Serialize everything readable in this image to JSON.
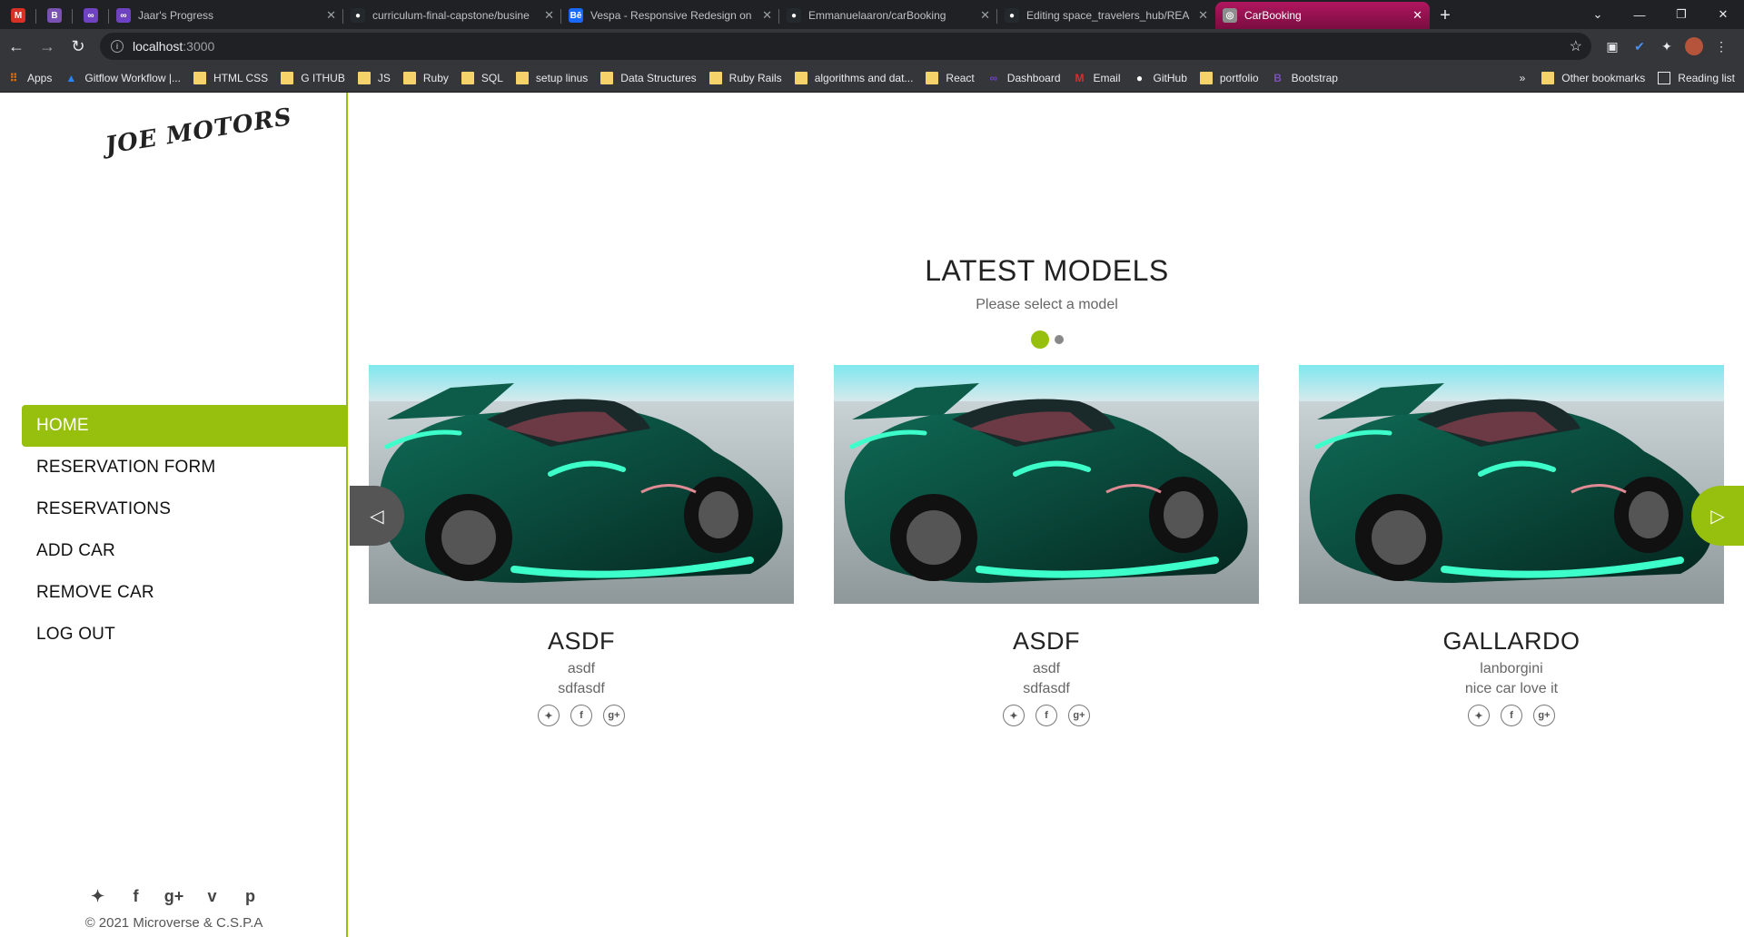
{
  "browser": {
    "tabs": [
      {
        "title": "",
        "icon": "gmail-icon",
        "color": "#d93025",
        "glyph": "M",
        "pinned": true
      },
      {
        "title": "",
        "icon": "bootstrap-icon",
        "color": "#7952b3",
        "glyph": "B",
        "pinned": true
      },
      {
        "title": "",
        "icon": "microverse-icon",
        "color": "#6f42c1",
        "glyph": "∞",
        "pinned": true
      },
      {
        "title": "Jaar's Progress",
        "icon": "microverse-icon",
        "color": "#6f42c1",
        "glyph": "∞"
      },
      {
        "title": "curriculum-final-capstone/busine",
        "icon": "github-icon",
        "color": "#24292e",
        "glyph": "●"
      },
      {
        "title": "Vespa - Responsive Redesign on",
        "icon": "behance-icon",
        "color": "#1769ff",
        "glyph": "Bē"
      },
      {
        "title": "Emmanuelaaron/carBooking",
        "icon": "github-icon",
        "color": "#24292e",
        "glyph": "●"
      },
      {
        "title": "Editing space_travelers_hub/REA",
        "icon": "github-icon",
        "color": "#24292e",
        "glyph": "●"
      },
      {
        "title": "CarBooking",
        "icon": "globe-icon",
        "color": "#8e8e8e",
        "glyph": "◎",
        "active": true
      }
    ],
    "url_host": "localhost",
    "url_port": ":3000",
    "bookmarks": [
      {
        "label": "Apps",
        "icon": "apps-icon",
        "color": "#e8710a"
      },
      {
        "label": "Gitflow Workflow |...",
        "icon": "atlassian-icon",
        "color": "#2684ff"
      },
      {
        "label": "HTML CSS",
        "icon": "folder-icon"
      },
      {
        "label": "G ITHUB",
        "icon": "folder-icon"
      },
      {
        "label": "JS",
        "icon": "folder-icon"
      },
      {
        "label": "Ruby",
        "icon": "folder-icon"
      },
      {
        "label": "SQL",
        "icon": "folder-icon"
      },
      {
        "label": "setup linus",
        "icon": "folder-icon"
      },
      {
        "label": "Data Structures",
        "icon": "folder-icon"
      },
      {
        "label": "Ruby Rails",
        "icon": "folder-icon"
      },
      {
        "label": "algorithms and dat...",
        "icon": "folder-icon"
      },
      {
        "label": "React",
        "icon": "folder-icon"
      },
      {
        "label": "Dashboard",
        "icon": "microverse-icon",
        "color": "#6f42c1"
      },
      {
        "label": "Email",
        "icon": "gmail-icon",
        "color": "#d93025"
      },
      {
        "label": "GitHub",
        "icon": "github-icon",
        "color": "#ffffff"
      },
      {
        "label": "portfolio",
        "icon": "folder-icon"
      },
      {
        "label": "Bootstrap",
        "icon": "bootstrap-icon",
        "color": "#7952b3"
      }
    ],
    "other_bookmarks": "Other bookmarks",
    "reading_list": "Reading list",
    "overflow": "»"
  },
  "app": {
    "logo": "JOE MOTORS",
    "nav": [
      {
        "label": "HOME",
        "active": true
      },
      {
        "label": "RESERVATION FORM"
      },
      {
        "label": "RESERVATIONS"
      },
      {
        "label": "ADD CAR"
      },
      {
        "label": "REMOVE CAR"
      },
      {
        "label": "LOG OUT"
      }
    ],
    "side_social": [
      "twitter-icon",
      "facebook-icon",
      "google-plus-icon",
      "vimeo-icon",
      "pinterest-icon"
    ],
    "copyright": "© 2021 Microverse & C.S.P.A",
    "heading": "LATEST MODELS",
    "subheading": "Please select a model",
    "carousel_pages": 2,
    "carousel_active": 0,
    "cars": [
      {
        "name": "ASDF",
        "make": "asdf",
        "description": "sdfasdf"
      },
      {
        "name": "ASDF",
        "make": "asdf",
        "description": "sdfasdf"
      },
      {
        "name": "GALLARDO",
        "make": "lanborgini",
        "description": "nice car love it"
      }
    ],
    "accent_color": "#97bf0d"
  }
}
